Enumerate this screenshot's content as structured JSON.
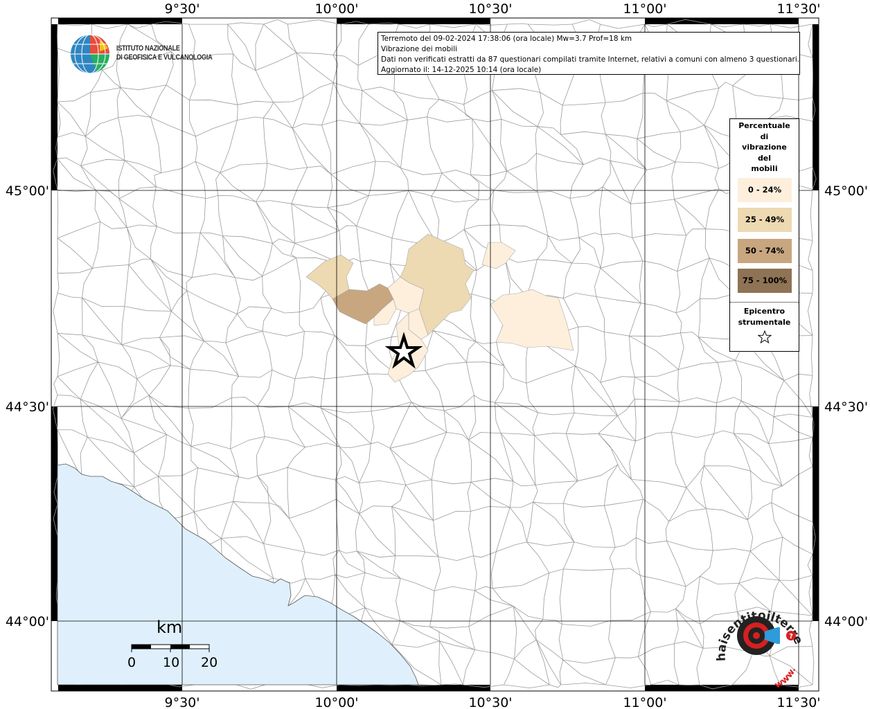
{
  "info": {
    "line1": "Terremoto del 09-02-2024 17:38:06 (ora locale) Mw=3.7 Prof=18 km",
    "line2": "Vibrazione dei mobili",
    "line3": "Dati non verificati estratti da 87 questionari compilati tramite Internet, relativi a comuni con almeno 3 questionari.",
    "line4": "Aggiornato il: 14-12-2025 10:14 (ora locale)"
  },
  "ingv": {
    "line1": "ISTITUTO NAZIONALE",
    "line2": "DI GEOFISICA E VULCANOLOGIA"
  },
  "legend": {
    "title_lines": [
      "Percentuale",
      "di",
      "vibrazione",
      "del",
      "mobili"
    ],
    "classes": [
      {
        "label": "0 - 24%",
        "color": "#fdefdc"
      },
      {
        "label": "25 - 49%",
        "color": "#edd9b2"
      },
      {
        "label": "50 - 74%",
        "color": "#c8a67f"
      },
      {
        "label": "75 - 100%",
        "color": "#8e7354"
      }
    ],
    "epicenter_lines": [
      "Epicentro",
      "strumentale"
    ]
  },
  "axes": {
    "lon_ticks": [
      "9°30'",
      "10°00'",
      "10°30'",
      "11°00'",
      "11°30'"
    ],
    "lat_ticks": [
      "45°00'",
      "44°30'",
      "44°00'"
    ]
  },
  "scale": {
    "unit": "km",
    "labels": [
      "0",
      "10",
      "20"
    ]
  },
  "hsi": {
    "text": "haisentitoilterremoto.it",
    "url": "www."
  },
  "colors": {
    "sea": "#dff0fc",
    "border": "#000000",
    "municipal_lines": "#9a9a9a"
  }
}
